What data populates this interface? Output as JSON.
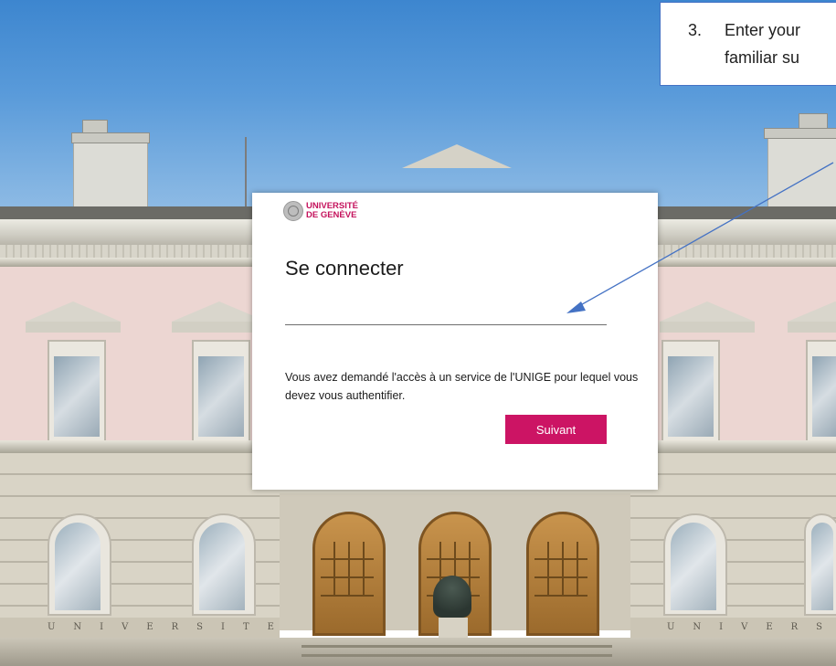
{
  "building": {
    "inscription": "UNIVERSITE"
  },
  "login": {
    "logo": {
      "line1": "UNIVERSITÉ",
      "line2": "DE GENÈVE"
    },
    "title": "Se connecter",
    "username_value": "",
    "description": "Vous avez demandé l'accès à un service de l'UNIGE pour lequel vous devez vous authentifier.",
    "next_button_label": "Suivant"
  },
  "annotation": {
    "number": "3.",
    "line1": "Enter your",
    "line2": "familiar su"
  },
  "colors": {
    "brand_magenta": "#c4125c",
    "button_magenta": "#cc1464",
    "callout_border": "#4472c4",
    "arrow": "#4472c4"
  },
  "icons": {
    "logo": "university-seal-icon",
    "arrow": "pointer-arrow"
  }
}
